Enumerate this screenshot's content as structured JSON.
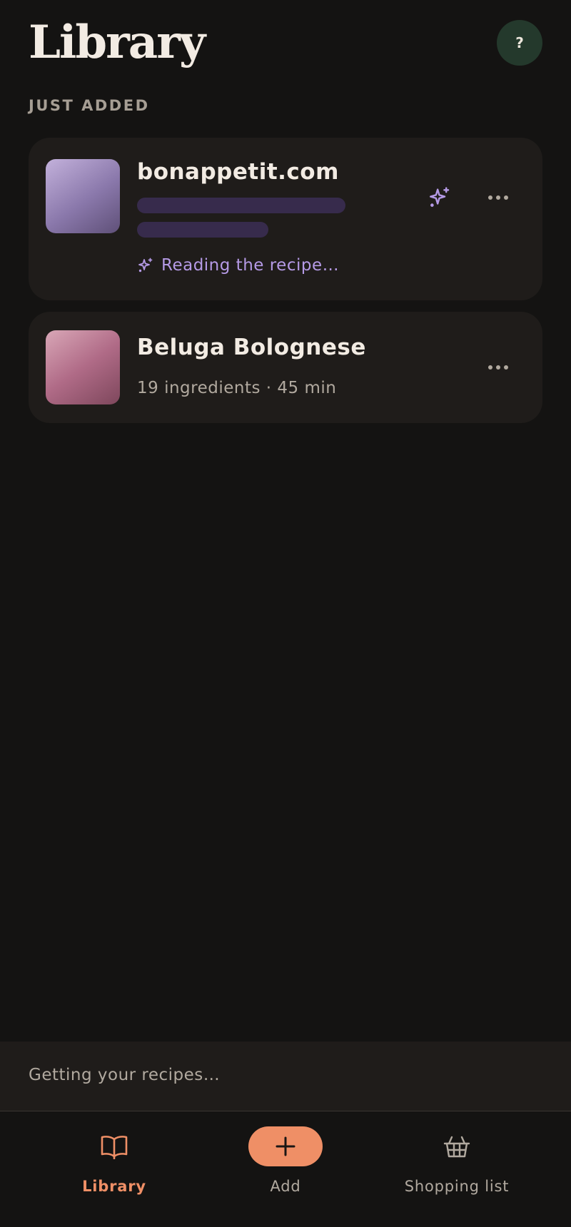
{
  "header": {
    "title": "Library",
    "help_label": "?"
  },
  "section": {
    "label": "JUST ADDED"
  },
  "recipes": [
    {
      "title": "bonappetit.com",
      "status": "Reading the recipe…",
      "thumb_colors": [
        "#c3b1db",
        "#5f5078"
      ],
      "icons": [
        "sparkle-icon",
        "more-icon"
      ]
    },
    {
      "title": "Beluga Bolognese",
      "meta": "19 ingredients · 45 min",
      "thumb_colors": [
        "#d9a7b7",
        "#7e475c"
      ],
      "icons": [
        "more-icon"
      ]
    }
  ],
  "loading": {
    "text": "Getting your recipes…"
  },
  "nav": {
    "items": [
      {
        "label": "Library",
        "icon": "book-icon",
        "active": true
      },
      {
        "label": "Add",
        "icon": "plus-icon",
        "active": false
      },
      {
        "label": "Shopping list",
        "icon": "basket-icon",
        "active": false
      }
    ]
  },
  "colors": {
    "background": "#141312",
    "card": "#1f1c1a",
    "accent": "#ef8f66",
    "processing": "#b59ae6",
    "help_button": "#24392c"
  }
}
